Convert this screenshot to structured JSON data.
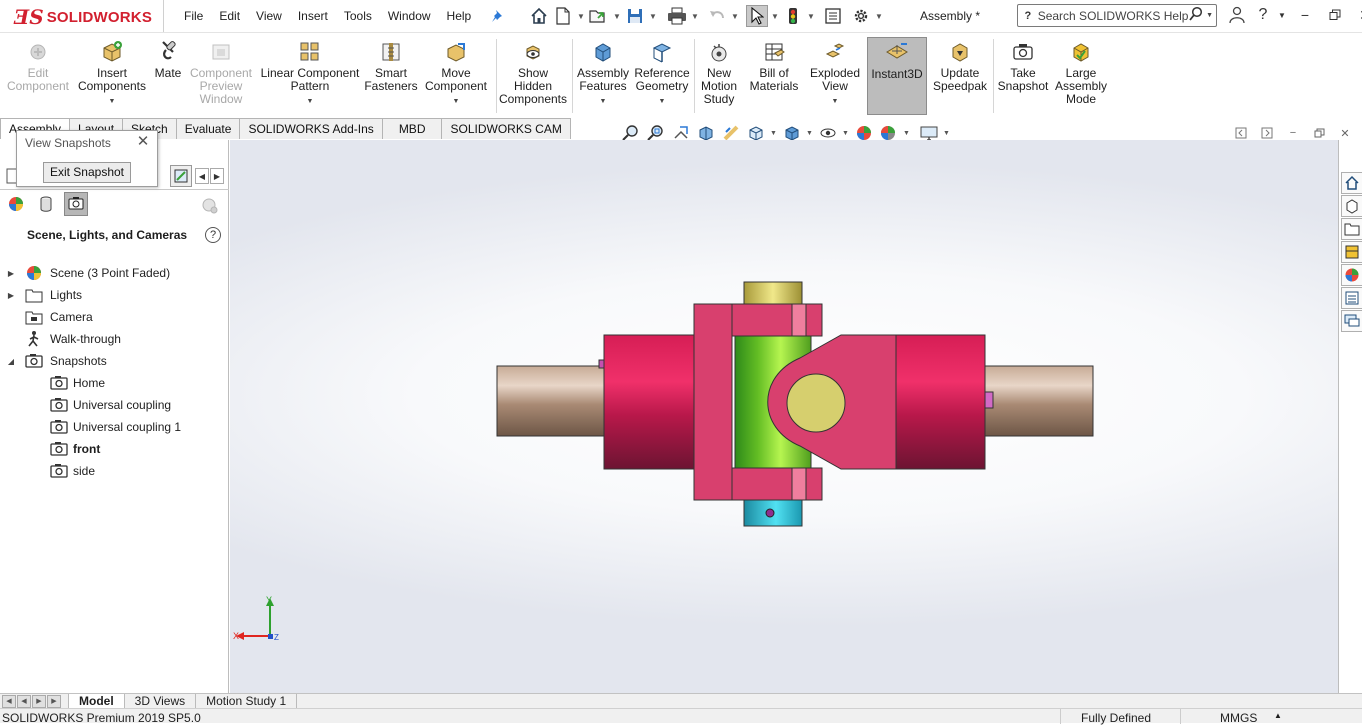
{
  "app": {
    "logo_text": "SOLIDWORKS",
    "document_title": "Assembly *"
  },
  "menu": [
    "File",
    "Edit",
    "View",
    "Insert",
    "Tools",
    "Window",
    "Help"
  ],
  "search": {
    "placeholder": "Search SOLIDWORKS Help"
  },
  "ribbon": [
    {
      "label": "Edit\nComponent",
      "icon": "edit-component-icon",
      "enabled": false
    },
    {
      "label": "Insert\nComponents",
      "icon": "insert-components-icon",
      "enabled": true
    },
    {
      "label": "Mate",
      "icon": "mate-icon",
      "enabled": true
    },
    {
      "label": "Component\nPreview\nWindow",
      "icon": "component-preview-icon",
      "enabled": false
    },
    {
      "label": "Linear Component\nPattern",
      "icon": "linear-pattern-icon",
      "enabled": true
    },
    {
      "label": "Smart\nFasteners",
      "icon": "smart-fasteners-icon",
      "enabled": true
    },
    {
      "label": "Move\nComponent",
      "icon": "move-component-icon",
      "enabled": true
    },
    {
      "label": "Show\nHidden\nComponents",
      "icon": "show-hidden-icon",
      "enabled": true
    },
    {
      "label": "Assembly\nFeatures",
      "icon": "assembly-features-icon",
      "enabled": true
    },
    {
      "label": "Reference\nGeometry",
      "icon": "reference-geometry-icon",
      "enabled": true
    },
    {
      "label": "New\nMotion\nStudy",
      "icon": "motion-study-icon",
      "enabled": true
    },
    {
      "label": "Bill of\nMaterials",
      "icon": "bom-icon",
      "enabled": true
    },
    {
      "label": "Exploded\nView",
      "icon": "exploded-view-icon",
      "enabled": true
    },
    {
      "label": "Instant3D",
      "icon": "instant3d-icon",
      "enabled": true,
      "active": true
    },
    {
      "label": "Update\nSpeedpak",
      "icon": "speedpak-icon",
      "enabled": true
    },
    {
      "label": "Take\nSnapshot",
      "icon": "camera-icon",
      "enabled": true
    },
    {
      "label": "Large\nAssembly\nMode",
      "icon": "large-assembly-icon",
      "enabled": true
    }
  ],
  "command_tabs": [
    "Assembly",
    "Layout",
    "Sketch",
    "Evaluate",
    "SOLIDWORKS Add-Ins",
    "MBD",
    "SOLIDWORKS CAM"
  ],
  "snapshot_popup": {
    "title": "View Snapshots",
    "button": "Exit Snapshot"
  },
  "panel": {
    "title": "Scene, Lights, and Cameras",
    "help": "?",
    "tree": [
      {
        "label": "Scene (3 Point Faded)",
        "level": 0,
        "expander": "collapsed",
        "icon": "scene-icon"
      },
      {
        "label": "Lights",
        "level": 0,
        "expander": "collapsed",
        "icon": "lights-icon"
      },
      {
        "label": "Camera",
        "level": 0,
        "expander": "none",
        "icon": "camera-folder-icon"
      },
      {
        "label": "Walk-through",
        "level": 0,
        "expander": "none",
        "icon": "walkthrough-icon"
      },
      {
        "label": "Snapshots",
        "level": 0,
        "expander": "expanded",
        "icon": "snapshots-icon"
      },
      {
        "label": "Home",
        "level": 1,
        "expander": "none",
        "icon": "snapshot-icon"
      },
      {
        "label": "Universal coupling",
        "level": 1,
        "expander": "none",
        "icon": "snapshot-icon"
      },
      {
        "label": "Universal coupling 1",
        "level": 1,
        "expander": "none",
        "icon": "snapshot-icon"
      },
      {
        "label": "front",
        "level": 1,
        "expander": "none",
        "icon": "snapshot-icon",
        "bold": true
      },
      {
        "label": "side",
        "level": 1,
        "expander": "none",
        "icon": "snapshot-icon"
      }
    ]
  },
  "triad": {
    "x_label": "X",
    "y_label": "Y",
    "z_label": "Z"
  },
  "bottom_tabs": [
    "Model",
    "3D Views",
    "Motion Study 1"
  ],
  "status": {
    "product": "SOLIDWORKS Premium 2019 SP5.0",
    "state": "Fully Defined",
    "units": "MMGS"
  },
  "colors": {
    "brand_red": "#d2202f",
    "yoke_pink": "#d8406e",
    "sleeve_crimson": "#c0184a",
    "spider_green": "#7ed321",
    "shaft_tan": "#a98a74",
    "pin_khaki": "#d8d070",
    "bushing_cyan": "#2bc8de"
  }
}
